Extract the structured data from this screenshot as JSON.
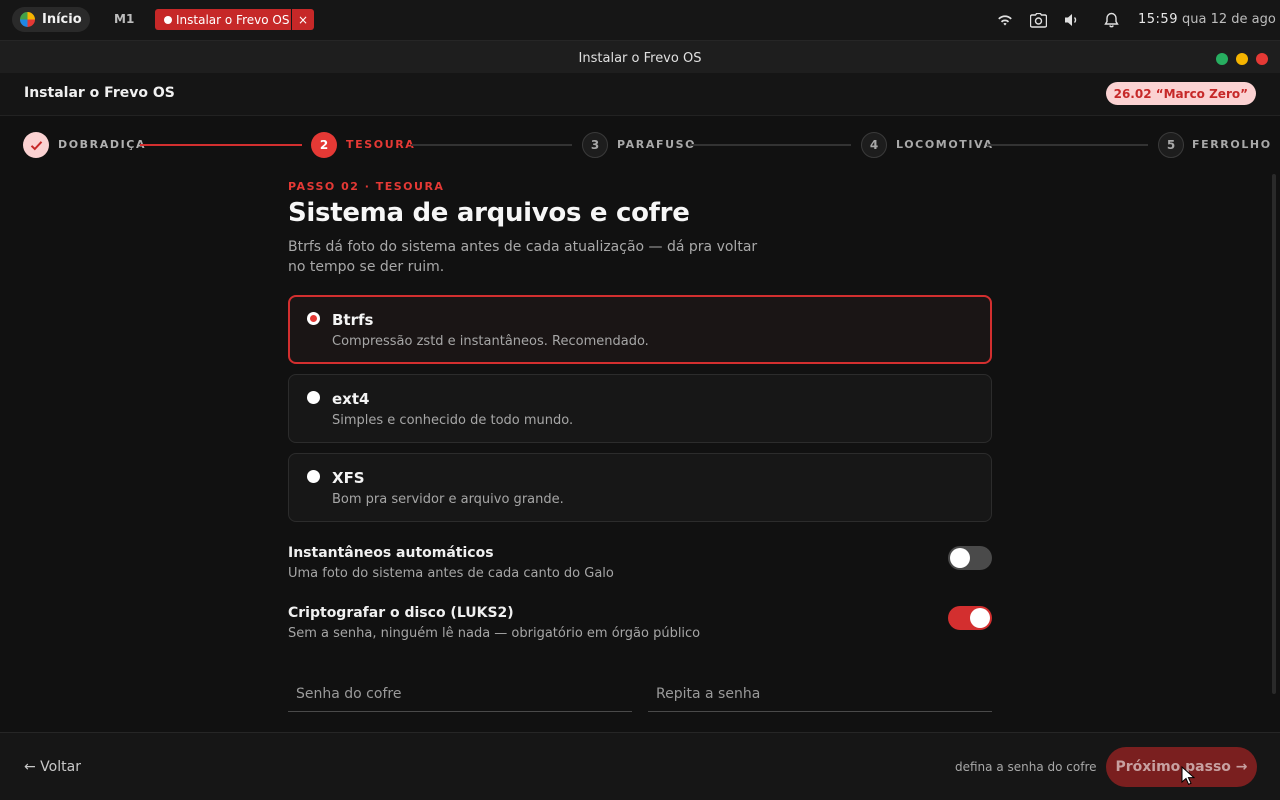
{
  "topbar": {
    "start_label": "Início",
    "workspace": "M1",
    "task_label": "Instalar o Frevo OS",
    "task_close": "×",
    "clock": "15:59",
    "date": "qua 12 de ago"
  },
  "window": {
    "title": "Instalar o Frevo OS",
    "controls": {
      "maximize_color": "#27ae60",
      "minimize_color": "#f5b400",
      "close_color": "#e53935"
    }
  },
  "header": {
    "title": "Instalar o Frevo OS",
    "version": "26.02 “Marco Zero”"
  },
  "stepper": {
    "steps": [
      {
        "num": "✓",
        "label": "DOBRADIÇA",
        "state": "done"
      },
      {
        "num": "2",
        "label": "TESOURA",
        "state": "current"
      },
      {
        "num": "3",
        "label": "PARAFUSO",
        "state": "pending"
      },
      {
        "num": "4",
        "label": "LOCOMOTIVA",
        "state": "pending"
      },
      {
        "num": "5",
        "label": "FERROLHO",
        "state": "pending"
      }
    ]
  },
  "main": {
    "eyebrow": "PASSO 02 · TESOURA",
    "title": "Sistema de arquivos e cofre",
    "description": "Btrfs dá foto do sistema antes de cada atualização — dá pra voltar no tempo se der ruim.",
    "filesystems": [
      {
        "name": "Btrfs",
        "desc": "Compressão zstd e instantâneos. Recomendado.",
        "selected": true
      },
      {
        "name": "ext4",
        "desc": "Simples e conhecido de todo mundo.",
        "selected": false
      },
      {
        "name": "XFS",
        "desc": "Bom pra servidor e arquivo grande.",
        "selected": false
      }
    ],
    "settings": [
      {
        "name": "Instantâneos automáticos",
        "desc": "Uma foto do sistema antes de cada canto do Galo",
        "on": false
      },
      {
        "name": "Criptografar o disco (LUKS2)",
        "desc": "Sem a senha, ninguém lê nada — obrigatório em órgão público",
        "on": true
      }
    ],
    "password_placeholder": "Senha do cofre",
    "password_repeat_placeholder": "Repita a senha"
  },
  "footer": {
    "back_label": "← Voltar",
    "hint": "defina a senha do cofre",
    "next_label": "Próximo passo →"
  },
  "colors": {
    "accent": "#e53935",
    "accent_dark": "#c62828",
    "toggle_off": "#4a4a4a"
  }
}
